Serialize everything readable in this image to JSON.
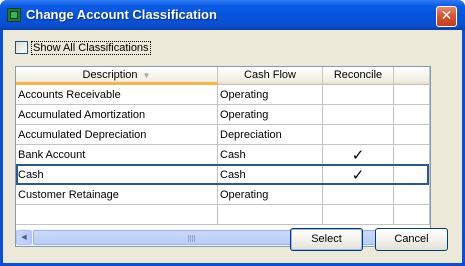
{
  "window": {
    "title": "Change Account Classification",
    "close_glyph": "✕"
  },
  "options": {
    "show_all_label": "Show All Classifications",
    "show_all_checked": false
  },
  "grid": {
    "columns": [
      {
        "label": "Description",
        "sorted": true
      },
      {
        "label": "Cash Flow",
        "sorted": false
      },
      {
        "label": "Reconcile",
        "sorted": false
      }
    ],
    "rows": [
      {
        "description": "Accounts Receivable",
        "cash_flow": "Operating",
        "reconcile": ""
      },
      {
        "description": "Accumulated Amortization",
        "cash_flow": "Operating",
        "reconcile": ""
      },
      {
        "description": "Accumulated Depreciation",
        "cash_flow": "Depreciation",
        "reconcile": ""
      },
      {
        "description": "Bank Account",
        "cash_flow": "Cash",
        "reconcile": "✓"
      },
      {
        "description": "Cash",
        "cash_flow": "Cash",
        "reconcile": "✓"
      },
      {
        "description": "Customer Retainage",
        "cash_flow": "Operating",
        "reconcile": ""
      },
      {
        "description": "",
        "cash_flow": "",
        "reconcile": ""
      }
    ],
    "selected_row": 4
  },
  "buttons": {
    "select": "Select",
    "cancel": "Cancel"
  },
  "colors": {
    "title_bar": "#0553dc",
    "dialog_bg": "#ece9d8",
    "selection_border": "#2a5797",
    "sort_indicator": "#f7b444",
    "close_button": "#d3532d"
  },
  "icons": {
    "app": "ledger-icon",
    "close": "close-icon",
    "sort": "sort-desc-icon",
    "scroll_up": "arrow-up-icon",
    "scroll_down": "arrow-down-icon",
    "scroll_left": "arrow-left-icon",
    "scroll_right": "arrow-right-icon"
  }
}
